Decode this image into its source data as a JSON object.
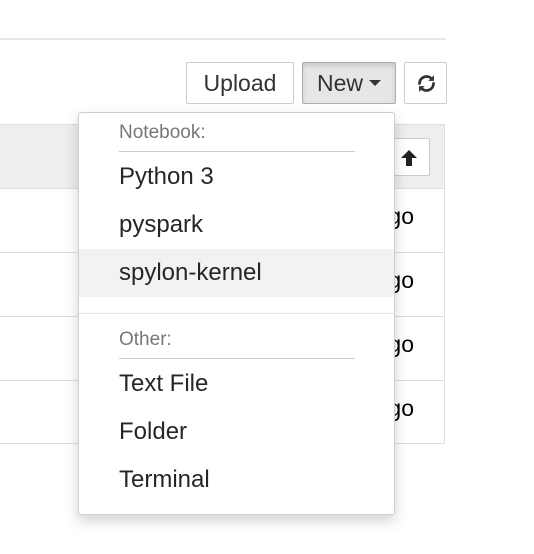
{
  "toolbar": {
    "upload_label": "Upload",
    "new_label": "New",
    "refresh_icon": "refresh-icon"
  },
  "file_list": {
    "sort_icon": "arrow-up-icon",
    "rows": [
      {
        "time_fragment": "go"
      },
      {
        "time_fragment": "go"
      },
      {
        "time_fragment": "go"
      },
      {
        "time_fragment": "go"
      }
    ]
  },
  "new_menu": {
    "notebook_header": "Notebook:",
    "notebook_items": [
      {
        "label": "Python 3"
      },
      {
        "label": "pyspark"
      },
      {
        "label": "spylon-kernel"
      }
    ],
    "other_header": "Other:",
    "other_items": [
      {
        "label": "Text File"
      },
      {
        "label": "Folder"
      },
      {
        "label": "Terminal"
      }
    ],
    "highlighted_item": "spylon-kernel"
  },
  "colors": {
    "highlight_bg": "#f2f2f2",
    "header_text": "#777777",
    "active_button_bg": "#e6e6e6"
  }
}
